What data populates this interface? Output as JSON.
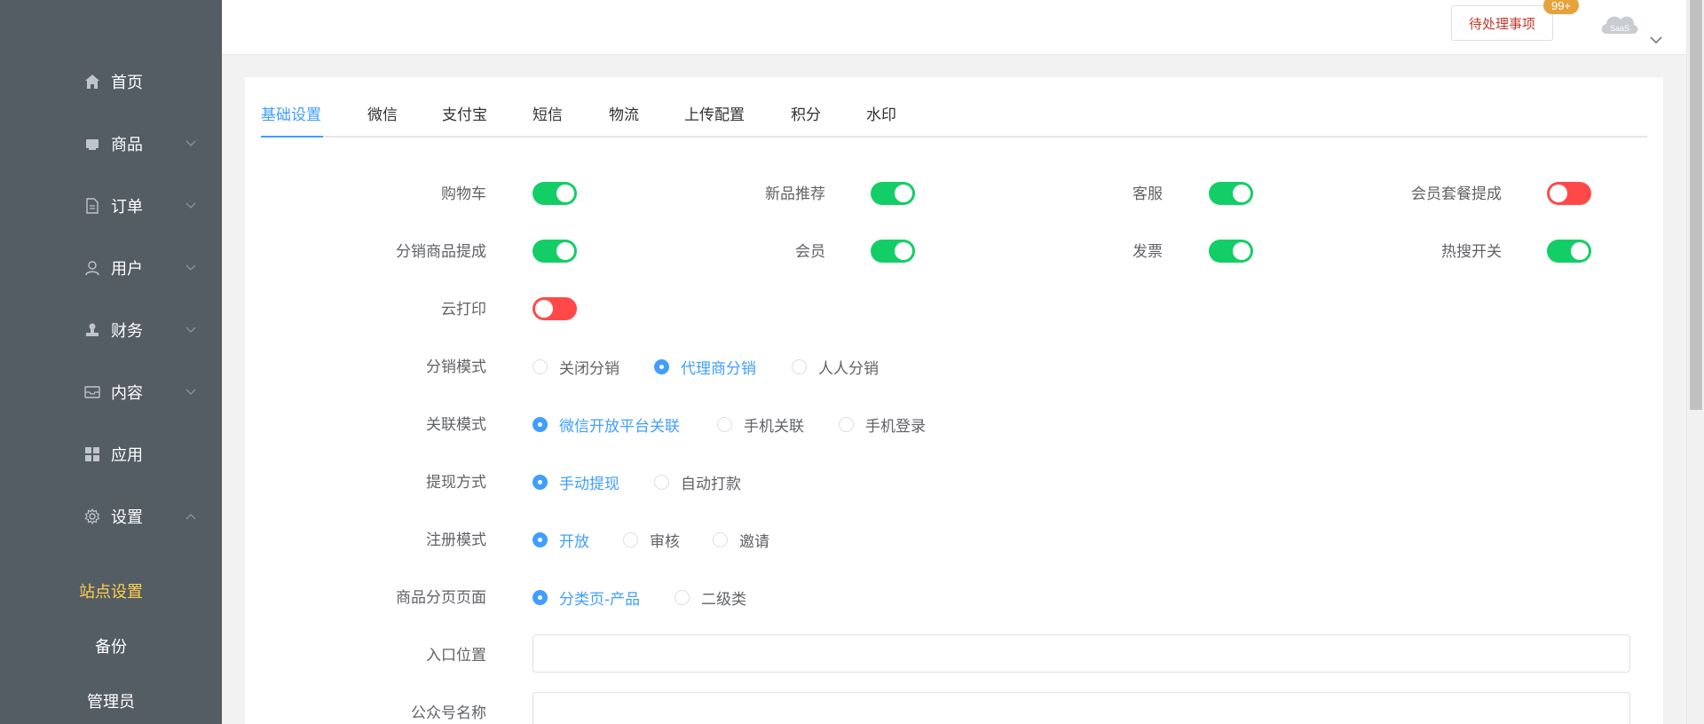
{
  "sidebar": {
    "items": [
      {
        "label": "首页",
        "icon": "home-icon",
        "has_arrow": false
      },
      {
        "label": "商品",
        "icon": "goods-icon",
        "has_arrow": true
      },
      {
        "label": "订单",
        "icon": "order-document-icon",
        "has_arrow": true
      },
      {
        "label": "用户",
        "icon": "user-icon",
        "has_arrow": true
      },
      {
        "label": "财务",
        "icon": "finance-stamp-icon",
        "has_arrow": true
      },
      {
        "label": "内容",
        "icon": "content-inbox-icon",
        "has_arrow": true
      },
      {
        "label": "应用",
        "icon": "apps-grid-icon",
        "has_arrow": false
      },
      {
        "label": "设置",
        "icon": "settings-gear-icon",
        "has_arrow": true,
        "expanded": true
      }
    ],
    "sub_items": [
      {
        "label": "站点设置",
        "active": true
      },
      {
        "label": "备份",
        "active": false
      },
      {
        "label": "管理员",
        "active": false
      }
    ],
    "background": "#545c64",
    "active_color": "#ffd04b"
  },
  "header": {
    "pending_button": "待处理事项",
    "badge": "99+",
    "avatar_text": "SaaS"
  },
  "tabs": {
    "items": [
      "基础设置",
      "微信",
      "支付宝",
      "短信",
      "物流",
      "上传配置",
      "积分",
      "水印"
    ],
    "active_index": 0
  },
  "switches": {
    "shopping_cart": {
      "label": "购物车",
      "on": true
    },
    "new_recommend": {
      "label": "新品推荐",
      "on": true
    },
    "customer_service": {
      "label": "客服",
      "on": true
    },
    "member_package_commission": {
      "label": "会员套餐提成",
      "on": false
    },
    "distribution_commission": {
      "label": "分销商品提成",
      "on": true
    },
    "member": {
      "label": "会员",
      "on": true
    },
    "invoice": {
      "label": "发票",
      "on": true
    },
    "hot_search": {
      "label": "热搜开关",
      "on": true
    },
    "cloud_print": {
      "label": "云打印",
      "on": false
    }
  },
  "radios": {
    "distribution_mode": {
      "label": "分销模式",
      "options": [
        "关闭分销",
        "代理商分销",
        "人人分销"
      ],
      "selected": 1
    },
    "link_mode": {
      "label": "关联模式",
      "options": [
        "微信开放平台关联",
        "手机关联",
        "手机登录"
      ],
      "selected": 0
    },
    "withdraw_method": {
      "label": "提现方式",
      "options": [
        "手动提现",
        "自动打款"
      ],
      "selected": 0
    },
    "register_mode": {
      "label": "注册模式",
      "options": [
        "开放",
        "审核",
        "邀请"
      ],
      "selected": 0
    },
    "goods_page": {
      "label": "商品分页页面",
      "options": [
        "分类页-产品",
        "二级类"
      ],
      "selected": 0
    }
  },
  "inputs": {
    "entry_position": {
      "label": "入口位置",
      "value": ""
    },
    "official_account_name": {
      "label": "公众号名称",
      "value": ""
    }
  },
  "colors": {
    "switch_on": "#13ce66",
    "switch_off": "#ff4949",
    "primary": "#409eff",
    "badge": "#e6a23c"
  }
}
